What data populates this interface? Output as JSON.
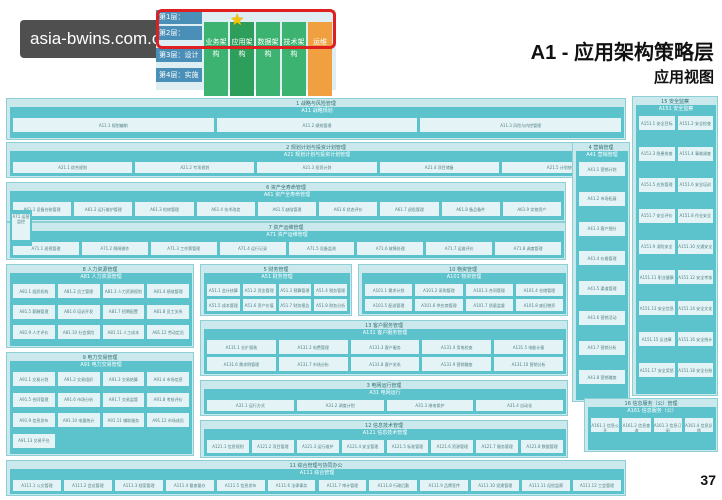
{
  "header": {
    "watermark": "asia-bwins.com.cn",
    "title": "A1 - 应用架构策略层",
    "subtitle": "应用视图",
    "page_number": "37"
  },
  "layer_strip": {
    "rows": [
      "第1层：",
      "第2层：",
      "第3层：设计",
      "第4层：实施"
    ],
    "columns": [
      "业务架构",
      "应用架构",
      "数据架构",
      "技术架构",
      "运维"
    ]
  },
  "domains": [
    {
      "id": "d1",
      "title": "1 战略与风险管理",
      "group": "A11 战略规划",
      "apps": [
        "A11.1 规划编制",
        "A11.2 绩效管理",
        "A11.3 风险与内控管理"
      ]
    },
    {
      "id": "d2",
      "title": "2 规划计划与投资计划管理",
      "group": "A21 规划计划与投资计划管理",
      "apps": [
        "A21.1 综合规划",
        "A21.2 专项规划",
        "A21.3 投资计划",
        "A21.4 项目储备",
        "A21.5 计划统计"
      ]
    },
    {
      "id": "d6",
      "title": "6 资产全寿命管理",
      "group": "A61 资产全寿命管理",
      "apps": [
        "A61.1 设备台账管理",
        "A61.2 运行维护管理",
        "A61.3 检修管理",
        "A61.4 技术改造",
        "A61.5 缺陷管理",
        "A61.6 状态评价",
        "A61.7 退役管理",
        "A61.8 备品备件",
        "A61.9 实物资产"
      ]
    },
    {
      "id": "d7",
      "title": "7 资产运维管理",
      "group": "A71 资产运维管理",
      "apps": [
        "A71.1 巡视管理",
        "A71.2 倒闸操作",
        "A71.3 工作票管理",
        "A71.4 运行记录",
        "A71.5 设备监测",
        "A71.6 故障处理",
        "A71.7 运维评价",
        "A71.8 调度管理"
      ]
    },
    {
      "id": "d8",
      "title": "8 人力资源管理",
      "group": "A81 人力资源管理",
      "apps": [
        "A81.1 组织机构",
        "A81.2 员工管理",
        "A81.3 人力资源规划",
        "A81.4 绩效管理",
        "A81.5 薪酬管理",
        "A81.6 培训开发",
        "A81.7 招聘配置",
        "A81.8 员工关系",
        "A81.9 人才评价",
        "A81.10 社会保险",
        "A81.11 人工成本",
        "A81.12 劳动定员"
      ]
    },
    {
      "id": "d5",
      "title": "5 财务管理",
      "group": "A51 财务管理",
      "apps": [
        "A51.1 会计核算",
        "A51.2 资金管理",
        "A51.3 预算管理",
        "A51.4 税务管理",
        "A51.5 成本管理",
        "A51.6 资产价值",
        "A51.7 财务报告",
        "A51.8 财务分析"
      ]
    },
    {
      "id": "d10",
      "title": "10 物资管理",
      "group": "A101 物资管理",
      "apps": [
        "A101.1 需求计划",
        "A101.2 采购管理",
        "A101.3 合同管理",
        "A101.4 仓储管理",
        "A101.5 配送管理",
        "A101.6 供应商管理",
        "A101.7 质量监督",
        "A101.8 废旧物资"
      ]
    },
    {
      "id": "d13",
      "title": "13 客户服务管理",
      "group": "A131 客户服务管理",
      "apps": [
        "A131.1 业扩报装",
        "A131.2 电费管理",
        "A131.3 客户服务",
        "A131.4 用电检查",
        "A131.5 电能计量",
        "A131.6 需求侧管理",
        "A131.7 市场分析",
        "A131.8 客户关系",
        "A131.9 营销稽查",
        "A131.10 营销分析"
      ]
    },
    {
      "id": "d9",
      "title": "9 电力交易管理",
      "group": "A91 电力交易管理",
      "apps": [
        "A91.1 交易计划",
        "A91.2 交易组织",
        "A91.3 交易结算",
        "A91.4 市场信息",
        "A91.5 合同管理",
        "A91.6 市场分析",
        "A91.7 交易监管",
        "A91.8 考核评价",
        "A91.9 信息发布",
        "A91.10 电量统计",
        "A91.11 辅助服务",
        "A91.12 市场成员",
        "A91.13 交易平台"
      ]
    },
    {
      "id": "d3",
      "title": "3 电网运行管理",
      "group": "A31 电网运行",
      "apps": [
        "A31.1 运行方式",
        "A31.2 调度计划",
        "A31.3 继电保护",
        "A31.4 自动化"
      ]
    },
    {
      "id": "d12",
      "title": "12 信息技术管理",
      "group": "A121 信息技术管理",
      "apps": [
        "A121.1 信息规划",
        "A121.2 项目管理",
        "A121.3 运行维护",
        "A121.4 安全管理",
        "A121.5 标准管理",
        "A121.6 资源管理",
        "A121.7 服务管理",
        "A121.8 数据管理"
      ]
    },
    {
      "id": "d11",
      "title": "11 综合管理与协同办公",
      "group": "A111 综合管理",
      "apps": [
        "A111.1 公文管理",
        "A111.2 会议管理",
        "A111.3 档案管理",
        "A111.4 督查督办",
        "A111.5 信息发布",
        "A111.6 法律事务",
        "A111.7 审计管理",
        "A111.8 行政后勤",
        "A111.9 品牌宣传",
        "A111.10 党建管理",
        "A111.11 纪检监察",
        "A111.12 工会管理"
      ]
    },
    {
      "id": "d4",
      "title": "4 营销管理",
      "group": "A41 营销管理",
      "apps": [
        "A41.1 营销计划",
        "A41.2 市场拓展",
        "A41.3 客户细分",
        "A41.4 价格管理",
        "A41.5 渠道管理",
        "A41.6 营销活动",
        "A41.7 营销分析",
        "A41.8 营销稽查"
      ]
    },
    {
      "id": "d15",
      "title": "15 安全监察",
      "group": "A151 安全监察",
      "apps": [
        "A151.1 安全目标",
        "A151.2 安全检查",
        "A151.3 隐患排查",
        "A151.4 事故调查",
        "A151.5 应急管理",
        "A151.6 安全培训",
        "A151.7 安全评价",
        "A151.8 作业安全",
        "A151.9 消防安全",
        "A151.10 交通安全",
        "A151.11 职业健康",
        "A151.12 安全考核",
        "A151.13 安全信息",
        "A151.14 安全文化",
        "A151.15 反违章",
        "A151.16 安全统计",
        "A151.17 安全奖惩",
        "A151.18 安全台账"
      ]
    },
    {
      "id": "d16",
      "title": "16 信息服务（公）管理",
      "group": "A161 信息服务（公）",
      "apps": [
        "A161.1 信息公开",
        "A161.2 信息查询",
        "A161.3 信息订阅",
        "A161.4 信息反馈"
      ]
    }
  ],
  "side_left": {
    "group": "A71 运营监控",
    "apps": [
      "A71.1"
    ]
  }
}
